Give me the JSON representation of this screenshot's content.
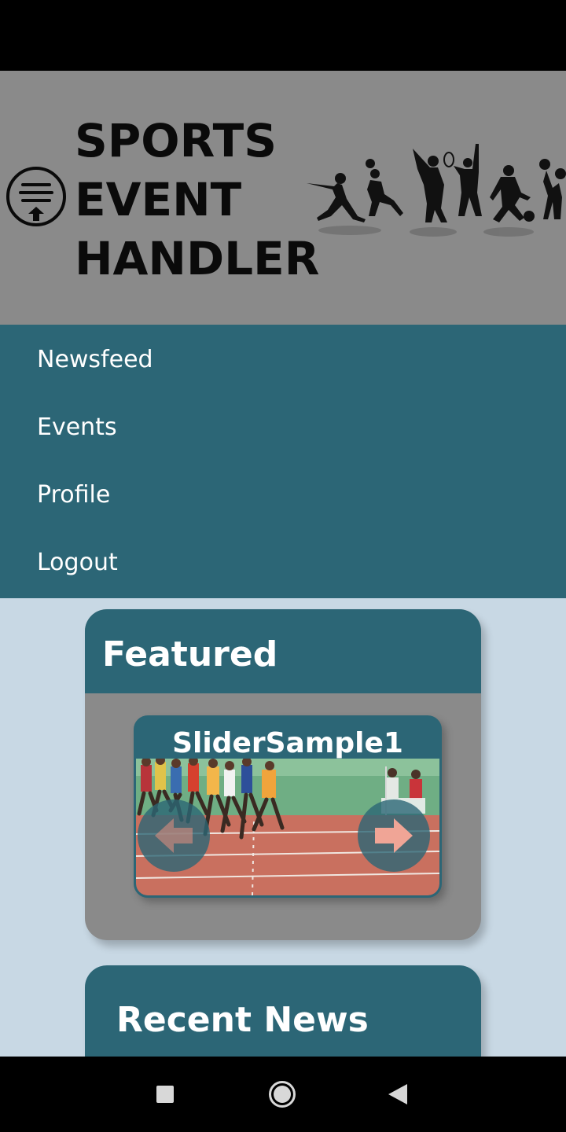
{
  "app": {
    "title_lines": [
      "SPORTS",
      "EVENT",
      "HANDLER"
    ]
  },
  "nav": {
    "items": [
      {
        "label": "Newsfeed"
      },
      {
        "label": "Events"
      },
      {
        "label": "Profile"
      },
      {
        "label": "Logout"
      }
    ]
  },
  "featured": {
    "title": "Featured",
    "slider": {
      "caption": "SliderSample1",
      "prev_icon": "arrow-left-icon",
      "next_icon": "arrow-right-icon"
    }
  },
  "recent_news": {
    "title": "Recent News"
  },
  "colors": {
    "primary": "#2c6676",
    "header_bg": "#8a8a8a",
    "page_bg": "#c8d8e4",
    "text_light": "#ffffff",
    "text_dark": "#0a0a0a"
  },
  "system_nav": {
    "recents_icon": "square-icon",
    "home_icon": "circle-home-icon",
    "back_icon": "triangle-back-icon"
  }
}
